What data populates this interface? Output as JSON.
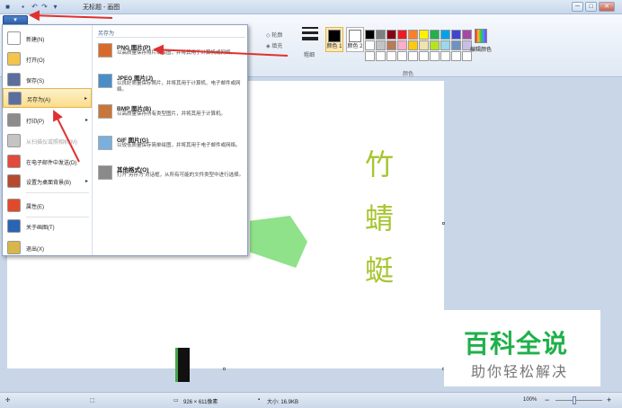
{
  "window": {
    "title": "无标题 - 画图",
    "quick_access": [
      "save-icon",
      "undo-icon",
      "redo-icon",
      "customize-icon"
    ],
    "controls": {
      "minimize": "─",
      "maximize": "□",
      "close": "✕"
    }
  },
  "ribbon": {
    "file_button": "▾",
    "tools": {
      "outline": "轮廓",
      "fill": "填充"
    },
    "size_label": "粗细",
    "color1_label": "颜色 1",
    "color2_label": "颜色 2",
    "edit_colors_label": "编辑颜色",
    "colors_group_label": "颜色",
    "color1": "#000000",
    "color2": "#ffffff",
    "palette": [
      "#000000",
      "#7f7f7f",
      "#880015",
      "#ed1c24",
      "#ff7f27",
      "#fff200",
      "#22b14c",
      "#00a2e8",
      "#3f48cc",
      "#a349a4",
      "#ffffff",
      "#c3c3c3",
      "#b97a57",
      "#ffaec9",
      "#ffc90e",
      "#efe4b0",
      "#b5e61d",
      "#99d9ea",
      "#7092be",
      "#c8bfe7",
      "#ffffff",
      "#ffffff",
      "#ffffff",
      "#ffffff",
      "#ffffff",
      "#ffffff",
      "#ffffff",
      "#ffffff",
      "#ffffff",
      "#ffffff"
    ]
  },
  "menu": {
    "items": [
      {
        "label": "新建(N)",
        "icon": "new-icon",
        "color": "#ffffff"
      },
      {
        "label": "打开(O)",
        "icon": "open-icon",
        "color": "#f3c54d"
      },
      {
        "label": "保存(S)",
        "icon": "save-icon",
        "color": "#5b6f9e"
      },
      {
        "label": "另存为(A)",
        "icon": "save-as-icon",
        "color": "#5b6f9e",
        "arrow": "▸",
        "highlighted": true
      },
      {
        "label": "打印(P)",
        "icon": "print-icon",
        "color": "#8c8c8c",
        "arrow": "▸"
      },
      {
        "label": "从扫描仪或照相机(M)",
        "icon": "scanner-icon",
        "color": "#c4c4c4",
        "disabled": true
      },
      {
        "label": "在电子邮件中发送(D)",
        "icon": "email-icon",
        "color": "#e24a3b"
      },
      {
        "label": "设置为桌面背景(B)",
        "icon": "desktop-background-icon",
        "color": "#b44a2f",
        "arrow": "▸"
      },
      {
        "label": "属性(E)",
        "icon": "properties-icon",
        "color": "#e04a2b"
      },
      {
        "label": "关于画图(T)",
        "icon": "about-icon",
        "color": "#2a64b4"
      },
      {
        "label": "退出(X)",
        "icon": "exit-icon",
        "color": "#d9b64a"
      }
    ],
    "submenu_title": "另存为",
    "submenu": [
      {
        "title": "PNG 图片(P)",
        "desc": "以高质量保存照片或绘图，并将其用于计算机或网络。",
        "icon": "png-icon",
        "color": "#d96b2a"
      },
      {
        "title": "JPEG 图片(J)",
        "desc": "以良好质量保存照片，并将其用于计算机、电子邮件或网络。",
        "icon": "jpeg-icon",
        "color": "#4a8ec9"
      },
      {
        "title": "BMP 图片(B)",
        "desc": "以高质量保存所有类型图片，并将其用于计算机。",
        "icon": "bmp-icon",
        "color": "#c9763a"
      },
      {
        "title": "GIF 图片(G)",
        "desc": "以较低质量保存简单绘图，并将其用于电子邮件或网络。",
        "icon": "gif-icon",
        "color": "#7bb0dc"
      },
      {
        "title": "其他格式(O)",
        "desc": "打开“另存为”对话框，从所有可能的文件类型中进行选择。",
        "icon": "other-formats-icon",
        "color": "#8a8a8a"
      }
    ]
  },
  "canvas": {
    "text_chars": [
      "竹",
      "蜻",
      "蜓"
    ],
    "shape_color": "#8fe28a",
    "text_color": "#a7c531"
  },
  "watermark": {
    "main": "百科全说",
    "sub": "助你轻松解决"
  },
  "status": {
    "dimensions": "926 × 611像素",
    "size": "大小: 16.9KB",
    "zoom": "100%",
    "zoom_out": "−",
    "zoom_in": "+"
  }
}
